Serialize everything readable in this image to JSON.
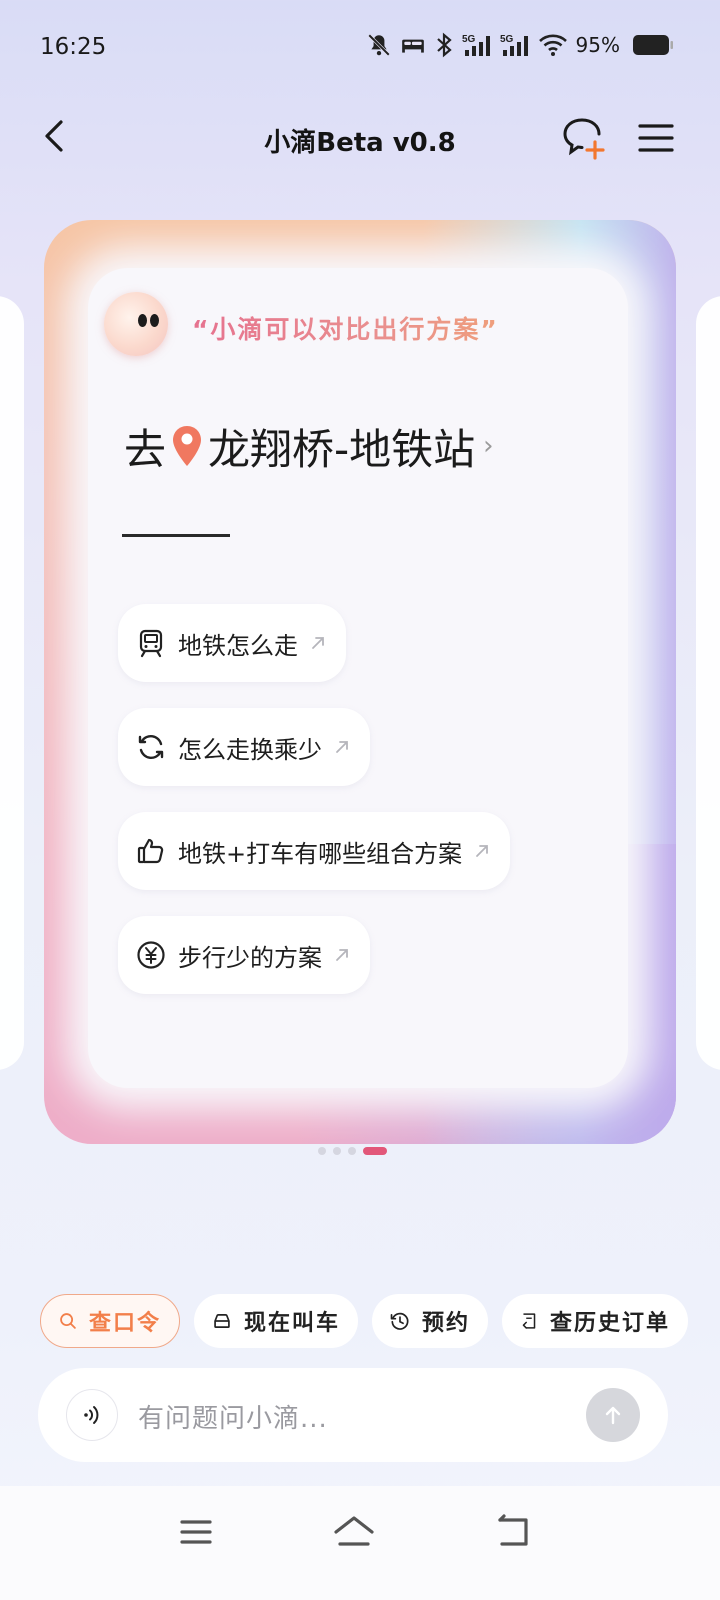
{
  "status_bar": {
    "time": "16:25",
    "battery": "95%",
    "icons": [
      "mute-icon",
      "bed-icon",
      "bluetooth-icon",
      "signal-5g-icon",
      "signal-5g-icon",
      "wifi-icon",
      "battery-icon"
    ],
    "network_labels": [
      "5G",
      "5G"
    ]
  },
  "header": {
    "title": "小滴Beta v0.8",
    "icons": [
      "back-icon",
      "new-chat-icon",
      "menu-icon"
    ]
  },
  "card": {
    "quote": "“小滴可以对比出行方案”",
    "dest_prefix": "去",
    "dest_name": "龙翔桥-地铁站",
    "dest_arrow": "›",
    "suggestions": [
      {
        "label": "地铁怎么走",
        "icon": "train-icon"
      },
      {
        "label": "怎么走换乘少",
        "icon": "refresh-icon"
      },
      {
        "label": "地铁+打车有哪些组合方案",
        "icon": "thumbs-up-icon"
      },
      {
        "label": "步行少的方案",
        "icon": "yuan-icon"
      }
    ]
  },
  "pager": {
    "count": 4,
    "active_index": 3
  },
  "quick_actions": [
    {
      "label": "查口令",
      "icon": "search-icon"
    },
    {
      "label": "现在叫车",
      "icon": "car-icon"
    },
    {
      "label": "预约",
      "icon": "clock-icon"
    },
    {
      "label": "查历史订单",
      "icon": "history-order-icon"
    }
  ],
  "input": {
    "placeholder": "有问题问小滴..."
  },
  "colors": {
    "accent_pink": "#e25779",
    "accent_orange": "#f27f4a",
    "text_dark": "#1e1e1e"
  }
}
